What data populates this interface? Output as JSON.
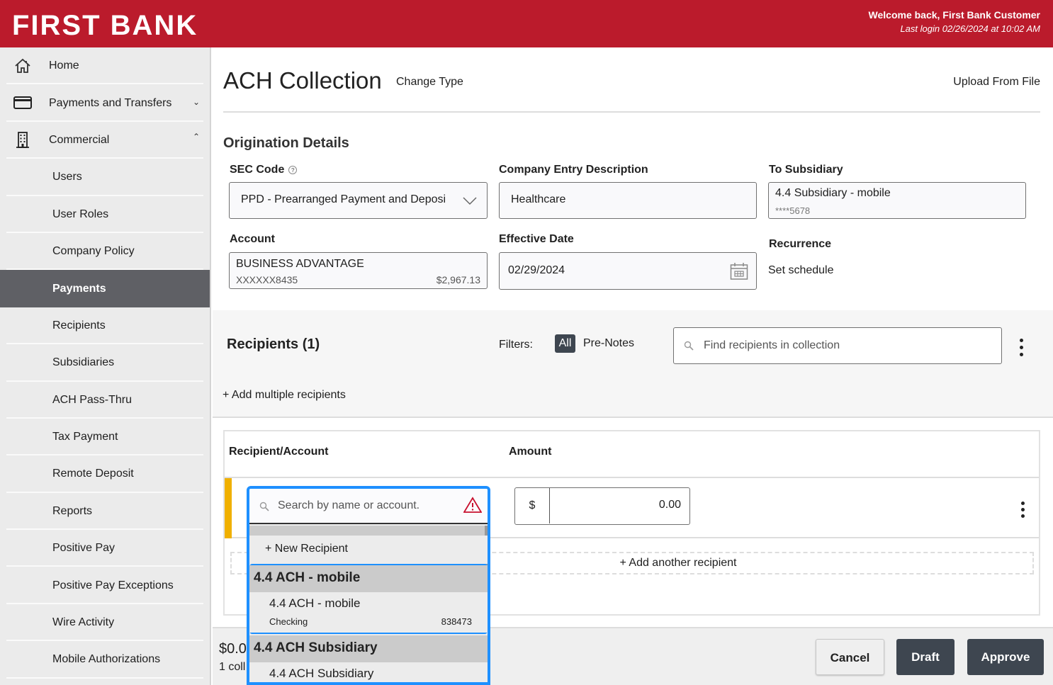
{
  "header": {
    "brand": "FIRST BANK",
    "welcome": "Welcome back, First Bank Customer",
    "last_login": "Last login 02/26/2024 at 10:02 AM",
    "brand_color": "#bb1b2c"
  },
  "sidebar": {
    "top_items": [
      {
        "label": "Home",
        "icon": "home-icon"
      },
      {
        "label": "Payments and Transfers",
        "icon": "credit-card-icon",
        "expanded": false
      },
      {
        "label": "Commercial",
        "icon": "building-icon",
        "expanded": true
      }
    ],
    "sub_items": [
      {
        "label": "Users"
      },
      {
        "label": "User Roles"
      },
      {
        "label": "Company Policy"
      },
      {
        "label": "Payments",
        "active": true
      },
      {
        "label": "Recipients"
      },
      {
        "label": "Subsidiaries"
      },
      {
        "label": "ACH Pass-Thru"
      },
      {
        "label": "Tax Payment"
      },
      {
        "label": "Remote Deposit"
      },
      {
        "label": "Reports"
      },
      {
        "label": "Positive Pay"
      },
      {
        "label": "Positive Pay Exceptions"
      },
      {
        "label": "Wire Activity"
      },
      {
        "label": "Mobile Authorizations"
      }
    ]
  },
  "page": {
    "title": "ACH Collection",
    "change_type": "Change Type",
    "upload": "Upload From File"
  },
  "origination": {
    "title": "Origination Details",
    "sec_code": {
      "label": "SEC Code",
      "value": "PPD - Prearranged Payment and Deposi"
    },
    "company_entry": {
      "label": "Company Entry Description",
      "value": "Healthcare"
    },
    "to_subsidiary": {
      "label": "To Subsidiary",
      "name": "4.4 Subsidiary - mobile",
      "account": "****5678"
    },
    "account": {
      "label": "Account",
      "name": "BUSINESS ADVANTAGE",
      "number": "XXXXXX8435",
      "balance": "$2,967.13"
    },
    "effective_date": {
      "label": "Effective Date",
      "value": "02/29/2024"
    },
    "recurrence": {
      "label": "Recurrence",
      "value": "Set schedule"
    }
  },
  "recipients": {
    "title": "Recipients (1)",
    "filters_label": "Filters:",
    "filters": [
      "All",
      "Pre-Notes"
    ],
    "active_filter": "All",
    "search_placeholder": "Find recipients in collection",
    "add_multiple": "+ Add multiple recipients",
    "columns": [
      "Recipient/Account",
      "Amount"
    ],
    "row": {
      "search_placeholder": "Search by name or account.",
      "currency": "$",
      "amount": "0.00"
    },
    "add_another": "+ Add another recipient"
  },
  "dropdown": {
    "new_recipient": "+ New Recipient",
    "groups": [
      {
        "name": "4.4 ACH - mobile",
        "options": [
          {
            "name": "4.4 ACH - mobile",
            "type": "Checking",
            "account": "838473"
          }
        ]
      },
      {
        "name": "4.4 ACH Subsidiary",
        "options": [
          {
            "name": "4.4 ACH Subsidiary"
          }
        ]
      }
    ]
  },
  "footer": {
    "total": "$0.0",
    "count": "1 coll",
    "cancel": "Cancel",
    "draft": "Draft",
    "approve": "Approve"
  }
}
